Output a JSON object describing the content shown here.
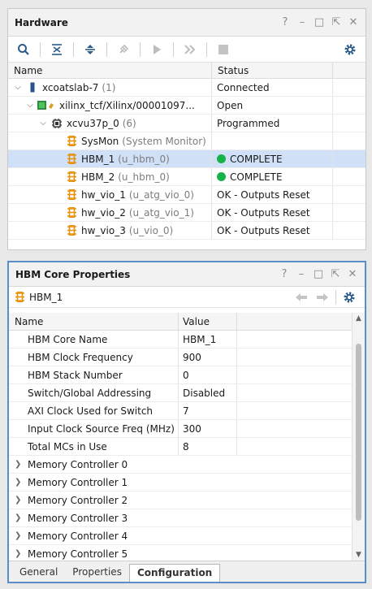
{
  "hardware": {
    "title": "Hardware",
    "window_controls": [
      "?",
      "_",
      "□",
      "⇱",
      "✕"
    ],
    "toolbar_icons": [
      "search-icon",
      "collapse-all-icon",
      "expand-all-icon",
      "auto-connect-icon",
      "run-icon",
      "run-all-icon",
      "stop-icon"
    ],
    "columns": {
      "name": "Name",
      "status": "Status"
    },
    "rows": [
      {
        "name": "xcoatslab-7",
        "suffix": "(1)",
        "status": "Connected"
      },
      {
        "name": "xilinx_tcf/Xilinx/00001097...",
        "suffix": "",
        "status": "Open"
      },
      {
        "name": "xcvu37p_0",
        "suffix": "(6)",
        "status": "Programmed"
      },
      {
        "name": "SysMon",
        "suffix": "(System Monitor)",
        "status": ""
      },
      {
        "name": "HBM_1",
        "suffix": "(u_hbm_0)",
        "status": "COMPLETE"
      },
      {
        "name": "HBM_2",
        "suffix": "(u_hbm_0)",
        "status": "COMPLETE"
      },
      {
        "name": "hw_vio_1",
        "suffix": "(u_atg_vio_0)",
        "status": "OK - Outputs Reset"
      },
      {
        "name": "hw_vio_2",
        "suffix": "(u_atg_vio_1)",
        "status": "OK - Outputs Reset"
      },
      {
        "name": "hw_vio_3",
        "suffix": "(u_vio_0)",
        "status": "OK - Outputs Reset"
      }
    ]
  },
  "hbm_props": {
    "title": "HBM Core Properties",
    "selected": "HBM_1",
    "columns": {
      "name": "Name",
      "value": "Value"
    },
    "properties": [
      {
        "name": "HBM Core Name",
        "value": "HBM_1"
      },
      {
        "name": "HBM Clock Frequency",
        "value": "900"
      },
      {
        "name": "HBM Stack Number",
        "value": "0"
      },
      {
        "name": "Switch/Global Addressing",
        "value": "Disabled"
      },
      {
        "name": "AXI Clock Used for Switch",
        "value": "7"
      },
      {
        "name": "Input Clock Source Freq (MHz)",
        "value": "300"
      },
      {
        "name": "Total MCs in Use",
        "value": "8"
      }
    ],
    "groups": [
      "Memory Controller 0",
      "Memory Controller 1",
      "Memory Controller 2",
      "Memory Controller 3",
      "Memory Controller 4",
      "Memory Controller 5"
    ],
    "tabs": [
      "General",
      "Properties",
      "Configuration"
    ],
    "active_tab": "Configuration"
  },
  "colors": {
    "accent": "#5b8ec9",
    "selected_row": "#cfe0f7",
    "complete_dot": "#18b24b",
    "ip_icon": "#e8900c"
  }
}
